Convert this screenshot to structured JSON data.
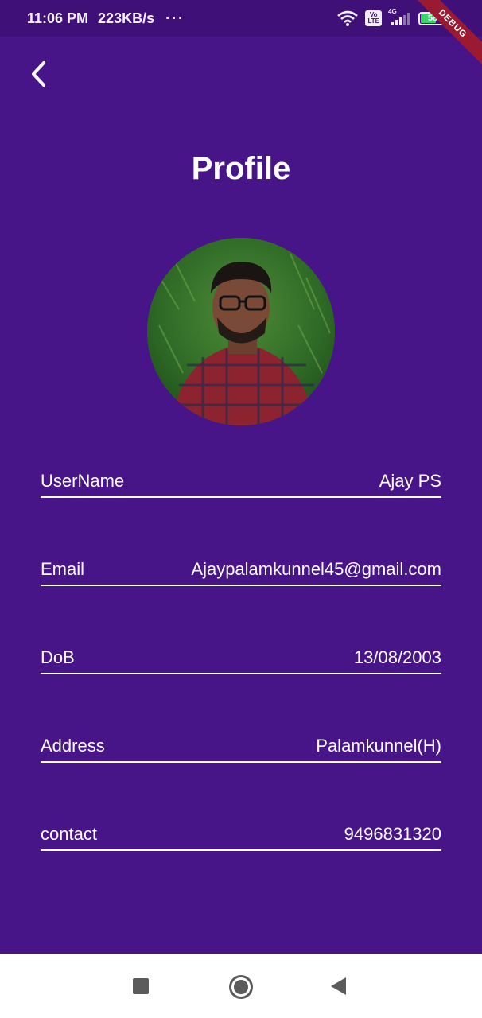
{
  "status_bar": {
    "time": "11:06 PM",
    "speed": "223KB/s",
    "more": "···",
    "volte": "Vo\nLTE",
    "network": "4G",
    "battery": "58"
  },
  "debug_ribbon": "DEBUG",
  "header": {
    "back_icon": "chevron-left-icon",
    "title": "Profile"
  },
  "profile": {
    "fields": [
      {
        "label": "UserName",
        "value": "Ajay PS"
      },
      {
        "label": "Email",
        "value": "Ajaypalamkunnel45@gmail.com"
      },
      {
        "label": "DoB",
        "value": "13/08/2003"
      },
      {
        "label": "Address",
        "value": "Palamkunnel(H)"
      },
      {
        "label": "contact",
        "value": "9496831320"
      }
    ]
  },
  "nav_bar": {
    "recent_icon": "square-icon",
    "home_icon": "circle-icon",
    "back_icon": "triangle-back-icon"
  },
  "colors": {
    "background": "#481589",
    "status_bar": "#3e1078",
    "text": "#ffffff",
    "ribbon": "#9a1b31"
  }
}
